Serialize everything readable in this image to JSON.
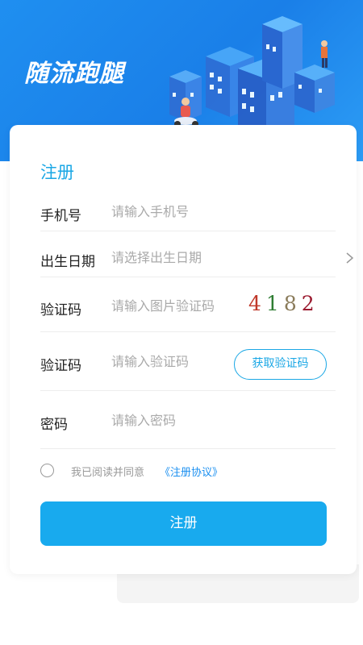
{
  "header": {
    "app_name": "随流跑腿",
    "bg_color": "#1a8ff0"
  },
  "form": {
    "title": "注册",
    "phone": {
      "label": "手机号",
      "placeholder": "请输入手机号"
    },
    "birthdate": {
      "label": "出生日期",
      "placeholder": "请选择出生日期",
      "icon": "chevron-right-icon"
    },
    "image_captcha": {
      "label": "验证码",
      "placeholder": "请输入图片验证码",
      "digits": [
        {
          "char": "4",
          "color": "#c0392b"
        },
        {
          "char": "1",
          "color": "#2e7d32"
        },
        {
          "char": "8",
          "color": "#8a7b5a"
        },
        {
          "char": "2",
          "color": "#9b1b30"
        }
      ]
    },
    "sms_code": {
      "label": "验证码",
      "placeholder": "请输入验证码",
      "button": "获取验证码"
    },
    "password": {
      "label": "密码",
      "placeholder": "请输入密码"
    },
    "agreement": {
      "text": "我已阅读并同意",
      "link": "《注册协议》"
    },
    "submit": "注册"
  },
  "colors": {
    "accent": "#1aa7e5",
    "button": "#18aaee",
    "link": "#1a8ff0"
  }
}
